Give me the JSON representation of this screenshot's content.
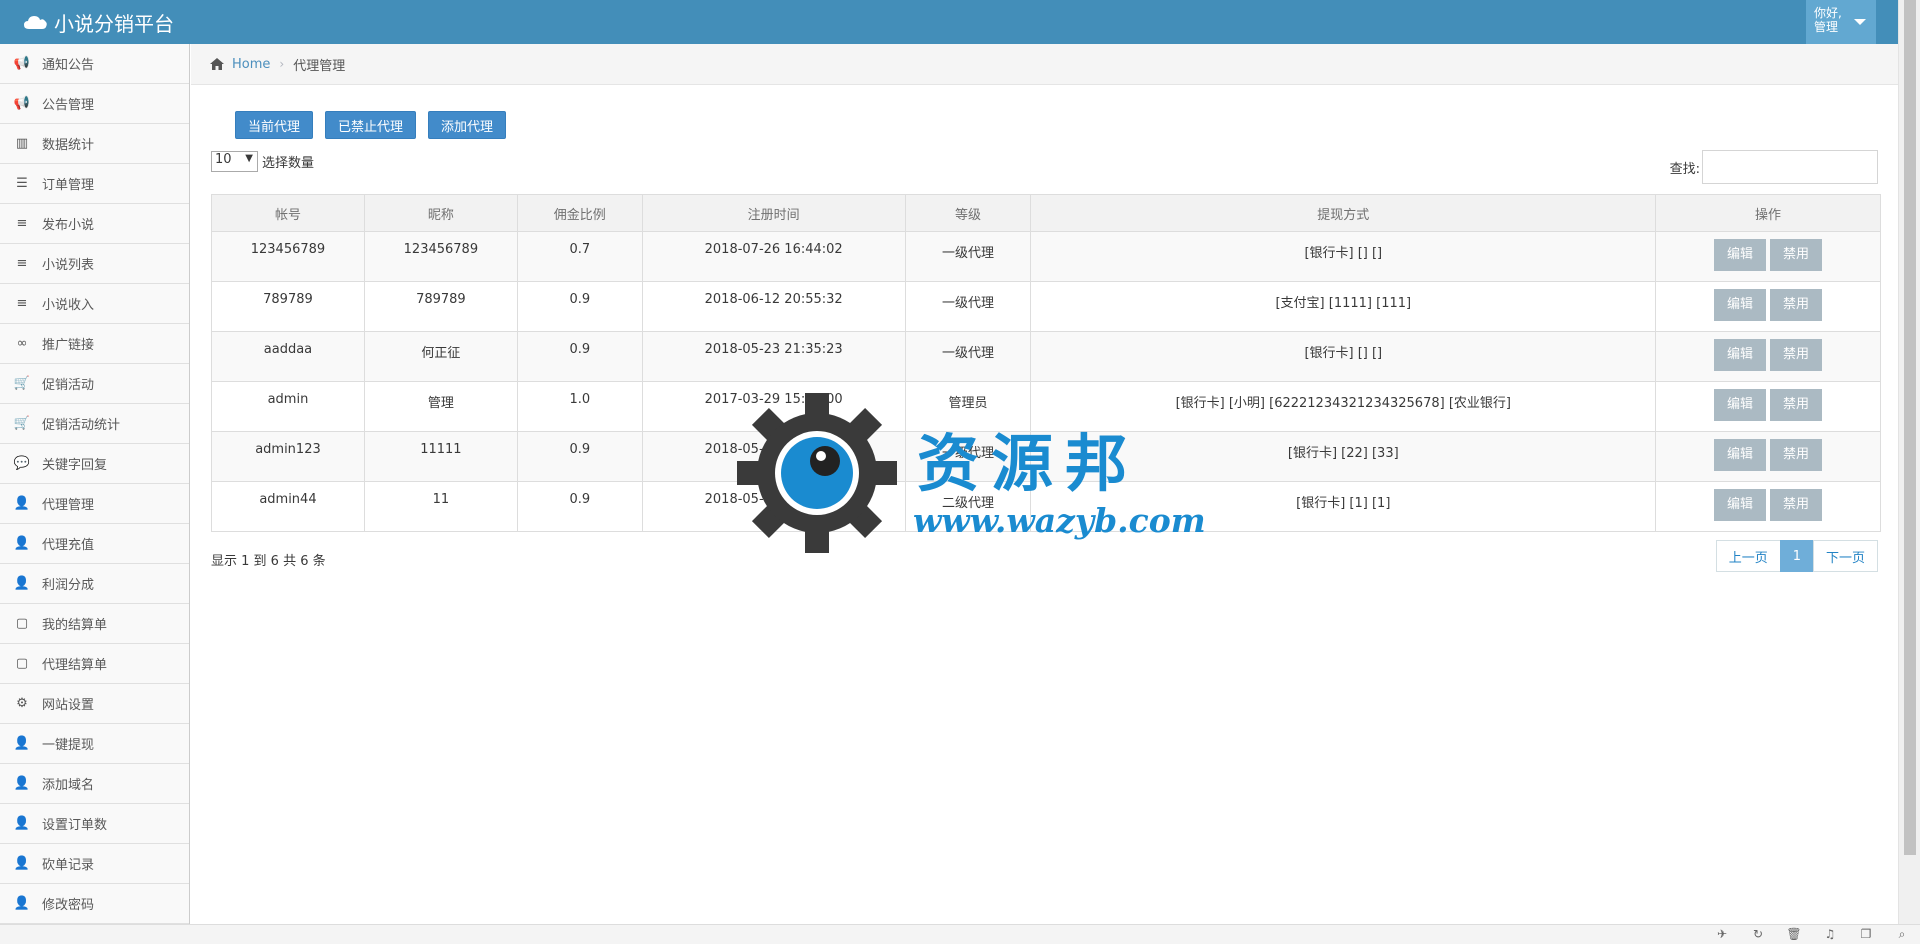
{
  "app": {
    "title": "小说分销平台"
  },
  "user": {
    "greeting": "你好,",
    "name": "管理"
  },
  "sidebar": {
    "items": [
      {
        "label": "通知公告",
        "icon": "megaphone-icon"
      },
      {
        "label": "公告管理",
        "icon": "megaphone-icon"
      },
      {
        "label": "数据统计",
        "icon": "bar-chart-icon"
      },
      {
        "label": "订单管理",
        "icon": "list-icon"
      },
      {
        "label": "发布小说",
        "icon": "server-icon"
      },
      {
        "label": "小说列表",
        "icon": "server-icon"
      },
      {
        "label": "小说收入",
        "icon": "server-icon"
      },
      {
        "label": "推广链接",
        "icon": "link-icon"
      },
      {
        "label": "促销活动",
        "icon": "cart-icon"
      },
      {
        "label": "促销活动统计",
        "icon": "cart-icon"
      },
      {
        "label": "关键字回复",
        "icon": "comment-icon"
      },
      {
        "label": "代理管理",
        "icon": "user-plus-icon"
      },
      {
        "label": "代理充值",
        "icon": "user-plus-icon"
      },
      {
        "label": "利润分成",
        "icon": "user-plus-icon"
      },
      {
        "label": "我的结算单",
        "icon": "note-icon"
      },
      {
        "label": "代理结算单",
        "icon": "note-icon"
      },
      {
        "label": "网站设置",
        "icon": "cogs-icon"
      },
      {
        "label": "一键提现",
        "icon": "user-plus-icon"
      },
      {
        "label": "添加域名",
        "icon": "user-plus-icon"
      },
      {
        "label": "设置订单数",
        "icon": "user-plus-icon"
      },
      {
        "label": "砍单记录",
        "icon": "user-plus-icon"
      },
      {
        "label": "修改密码",
        "icon": "user-plus-icon"
      }
    ]
  },
  "breadcrumb": {
    "home": "Home",
    "current": "代理管理"
  },
  "toolbar": {
    "current_agents": "当前代理",
    "disabled_agents": "已禁止代理",
    "add_agent": "添加代理"
  },
  "length": {
    "value": "10",
    "label": "选择数量"
  },
  "search": {
    "label": "查找:"
  },
  "table": {
    "headers": [
      "帐号",
      "昵称",
      "佣金比例",
      "注册时间",
      "等级",
      "提现方式",
      "操作"
    ],
    "edit_label": "编辑",
    "disable_label": "禁用",
    "rows": [
      {
        "account": "123456789",
        "nickname": "123456789",
        "ratio": "0.7",
        "registered": "2018-07-26 16:44:02",
        "level": "一级代理",
        "withdraw": "[银行卡] [] []"
      },
      {
        "account": "789789",
        "nickname": "789789",
        "ratio": "0.9",
        "registered": "2018-06-12 20:55:32",
        "level": "一级代理",
        "withdraw": "[支付宝] [1111] [111]"
      },
      {
        "account": "aaddaa",
        "nickname": "何正征",
        "ratio": "0.9",
        "registered": "2018-05-23 21:35:23",
        "level": "一级代理",
        "withdraw": "[银行卡] [] []"
      },
      {
        "account": "admin",
        "nickname": "管理",
        "ratio": "1.0",
        "registered": "2017-03-29 15:10:00",
        "level": "管理员",
        "withdraw": "[银行卡] [小明] [622212343212343256​78] [农业银行]"
      },
      {
        "account": "admin123",
        "nickname": "11111",
        "ratio": "0.9",
        "registered": "2018-05-08 11:13:16",
        "level": "一级代理",
        "withdraw": "[银行卡] [22] [33]"
      },
      {
        "account": "admin44",
        "nickname": "11",
        "ratio": "0.9",
        "registered": "2018-05-08 11:14:43",
        "level": "二级代理",
        "withdraw": "[银行卡] [1] [1]"
      }
    ]
  },
  "info": "显示 1 到 6 共 6 条",
  "pagination": {
    "prev": "上一页",
    "page": "1",
    "next": "下一页"
  },
  "watermark": {
    "text": "资源邦",
    "url": "www.wazyb.com"
  },
  "colors": {
    "navbar": "#438eb9",
    "primary": "#428bca",
    "action": "#abbac3",
    "watermark": "#1a8bd0"
  }
}
